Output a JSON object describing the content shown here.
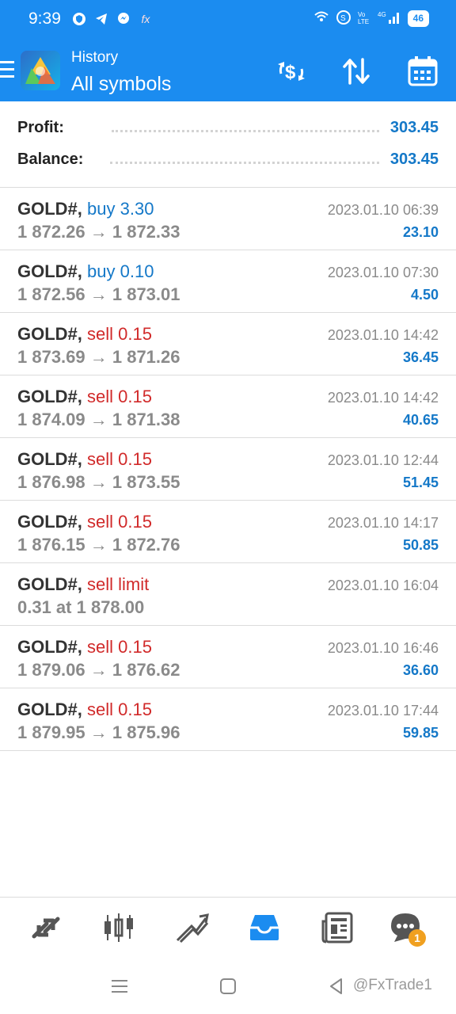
{
  "status_bar": {
    "time": "9:39",
    "battery": "46",
    "icons": [
      "vpn-shield-icon",
      "telegram-icon",
      "messenger-icon",
      "fx-icon"
    ]
  },
  "app_bar": {
    "subtitle": "History",
    "title": "All symbols"
  },
  "summary": {
    "profit_label": "Profit:",
    "profit_value": "303.45",
    "balance_label": "Balance:",
    "balance_value": "303.45"
  },
  "trades": [
    {
      "symbol": "GOLD#,",
      "side": "buy 3.30",
      "type": "buy",
      "prices": "1 872.26 → 1 872.33",
      "time": "2023.01.10 06:39",
      "profit": "23.10"
    },
    {
      "symbol": "GOLD#,",
      "side": "buy 0.10",
      "type": "buy",
      "prices": "1 872.56 → 1 873.01",
      "time": "2023.01.10 07:30",
      "profit": "4.50"
    },
    {
      "symbol": "GOLD#,",
      "side": "sell 0.15",
      "type": "sell",
      "prices": "1 873.69 → 1 871.26",
      "time": "2023.01.10 14:42",
      "profit": "36.45"
    },
    {
      "symbol": "GOLD#,",
      "side": "sell 0.15",
      "type": "sell",
      "prices": "1 874.09 → 1 871.38",
      "time": "2023.01.10 14:42",
      "profit": "40.65"
    },
    {
      "symbol": "GOLD#,",
      "side": "sell 0.15",
      "type": "sell",
      "prices": "1 876.98 → 1 873.55",
      "time": "2023.01.10 12:44",
      "profit": "51.45"
    },
    {
      "symbol": "GOLD#,",
      "side": "sell 0.15",
      "type": "sell",
      "prices": "1 876.15 → 1 872.76",
      "time": "2023.01.10 14:17",
      "profit": "50.85"
    },
    {
      "symbol": "GOLD#,",
      "side": "sell limit",
      "type": "sell",
      "prices": "0.31 at 1 878.00",
      "time": "2023.01.10 16:04",
      "profit": ""
    },
    {
      "symbol": "GOLD#,",
      "side": "sell 0.15",
      "type": "sell",
      "prices": "1 879.06 → 1 876.62",
      "time": "2023.01.10 16:46",
      "profit": "36.60"
    },
    {
      "symbol": "GOLD#,",
      "side": "sell 0.15",
      "type": "sell",
      "prices": "1 879.95 → 1 875.96",
      "time": "2023.01.10 17:44",
      "profit": "59.85"
    }
  ],
  "bottom_nav": {
    "items": [
      "quotes-icon",
      "chart-icon",
      "trade-icon",
      "history-icon",
      "news-icon",
      "messages-icon"
    ],
    "active": "history-icon",
    "messages_badge": "1"
  },
  "watermark": "@FxTrade1",
  "colors": {
    "accent": "#1b8cf0",
    "profit": "#1478c8",
    "sell": "#d12a2a",
    "buy": "#1478c8",
    "badge": "#f0a020"
  }
}
